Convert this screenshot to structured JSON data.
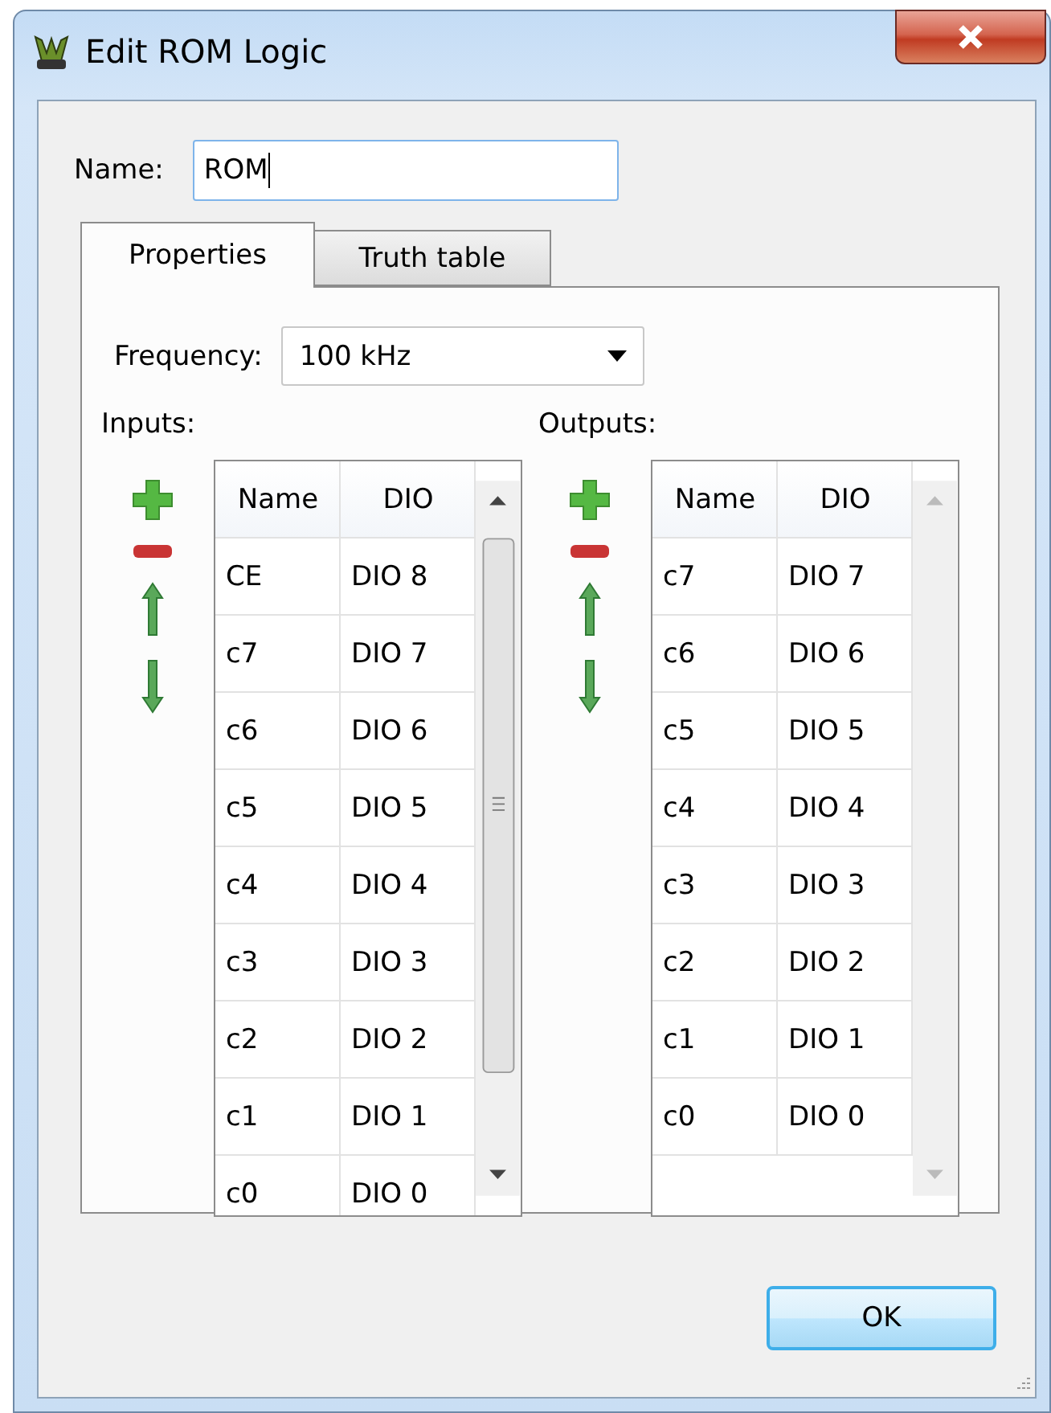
{
  "window": {
    "title": "Edit ROM Logic"
  },
  "name_field": {
    "label": "Name:",
    "value": "ROM"
  },
  "tabs": [
    {
      "label": "Properties",
      "selected": true
    },
    {
      "label": "Truth table",
      "selected": false
    }
  ],
  "frequency": {
    "label": "Frequency:",
    "value": "100 kHz"
  },
  "inputs": {
    "label": "Inputs:",
    "columns": [
      "Name",
      "DIO"
    ],
    "scrollable": true,
    "rows": [
      [
        "CE",
        "DIO 8"
      ],
      [
        "c7",
        "DIO 7"
      ],
      [
        "c6",
        "DIO 6"
      ],
      [
        "c5",
        "DIO 5"
      ],
      [
        "c4",
        "DIO 4"
      ],
      [
        "c3",
        "DIO 3"
      ],
      [
        "c2",
        "DIO 2"
      ],
      [
        "c1",
        "DIO 1"
      ],
      [
        "c0",
        "DIO 0"
      ]
    ]
  },
  "outputs": {
    "label": "Outputs:",
    "columns": [
      "Name",
      "DIO"
    ],
    "scrollable": false,
    "rows": [
      [
        "c7",
        "DIO 7"
      ],
      [
        "c6",
        "DIO 6"
      ],
      [
        "c5",
        "DIO 5"
      ],
      [
        "c4",
        "DIO 4"
      ],
      [
        "c3",
        "DIO 3"
      ],
      [
        "c2",
        "DIO 2"
      ],
      [
        "c1",
        "DIO 1"
      ],
      [
        "c0",
        "DIO 0"
      ]
    ]
  },
  "buttons": [
    {
      "label": "OK"
    }
  ]
}
